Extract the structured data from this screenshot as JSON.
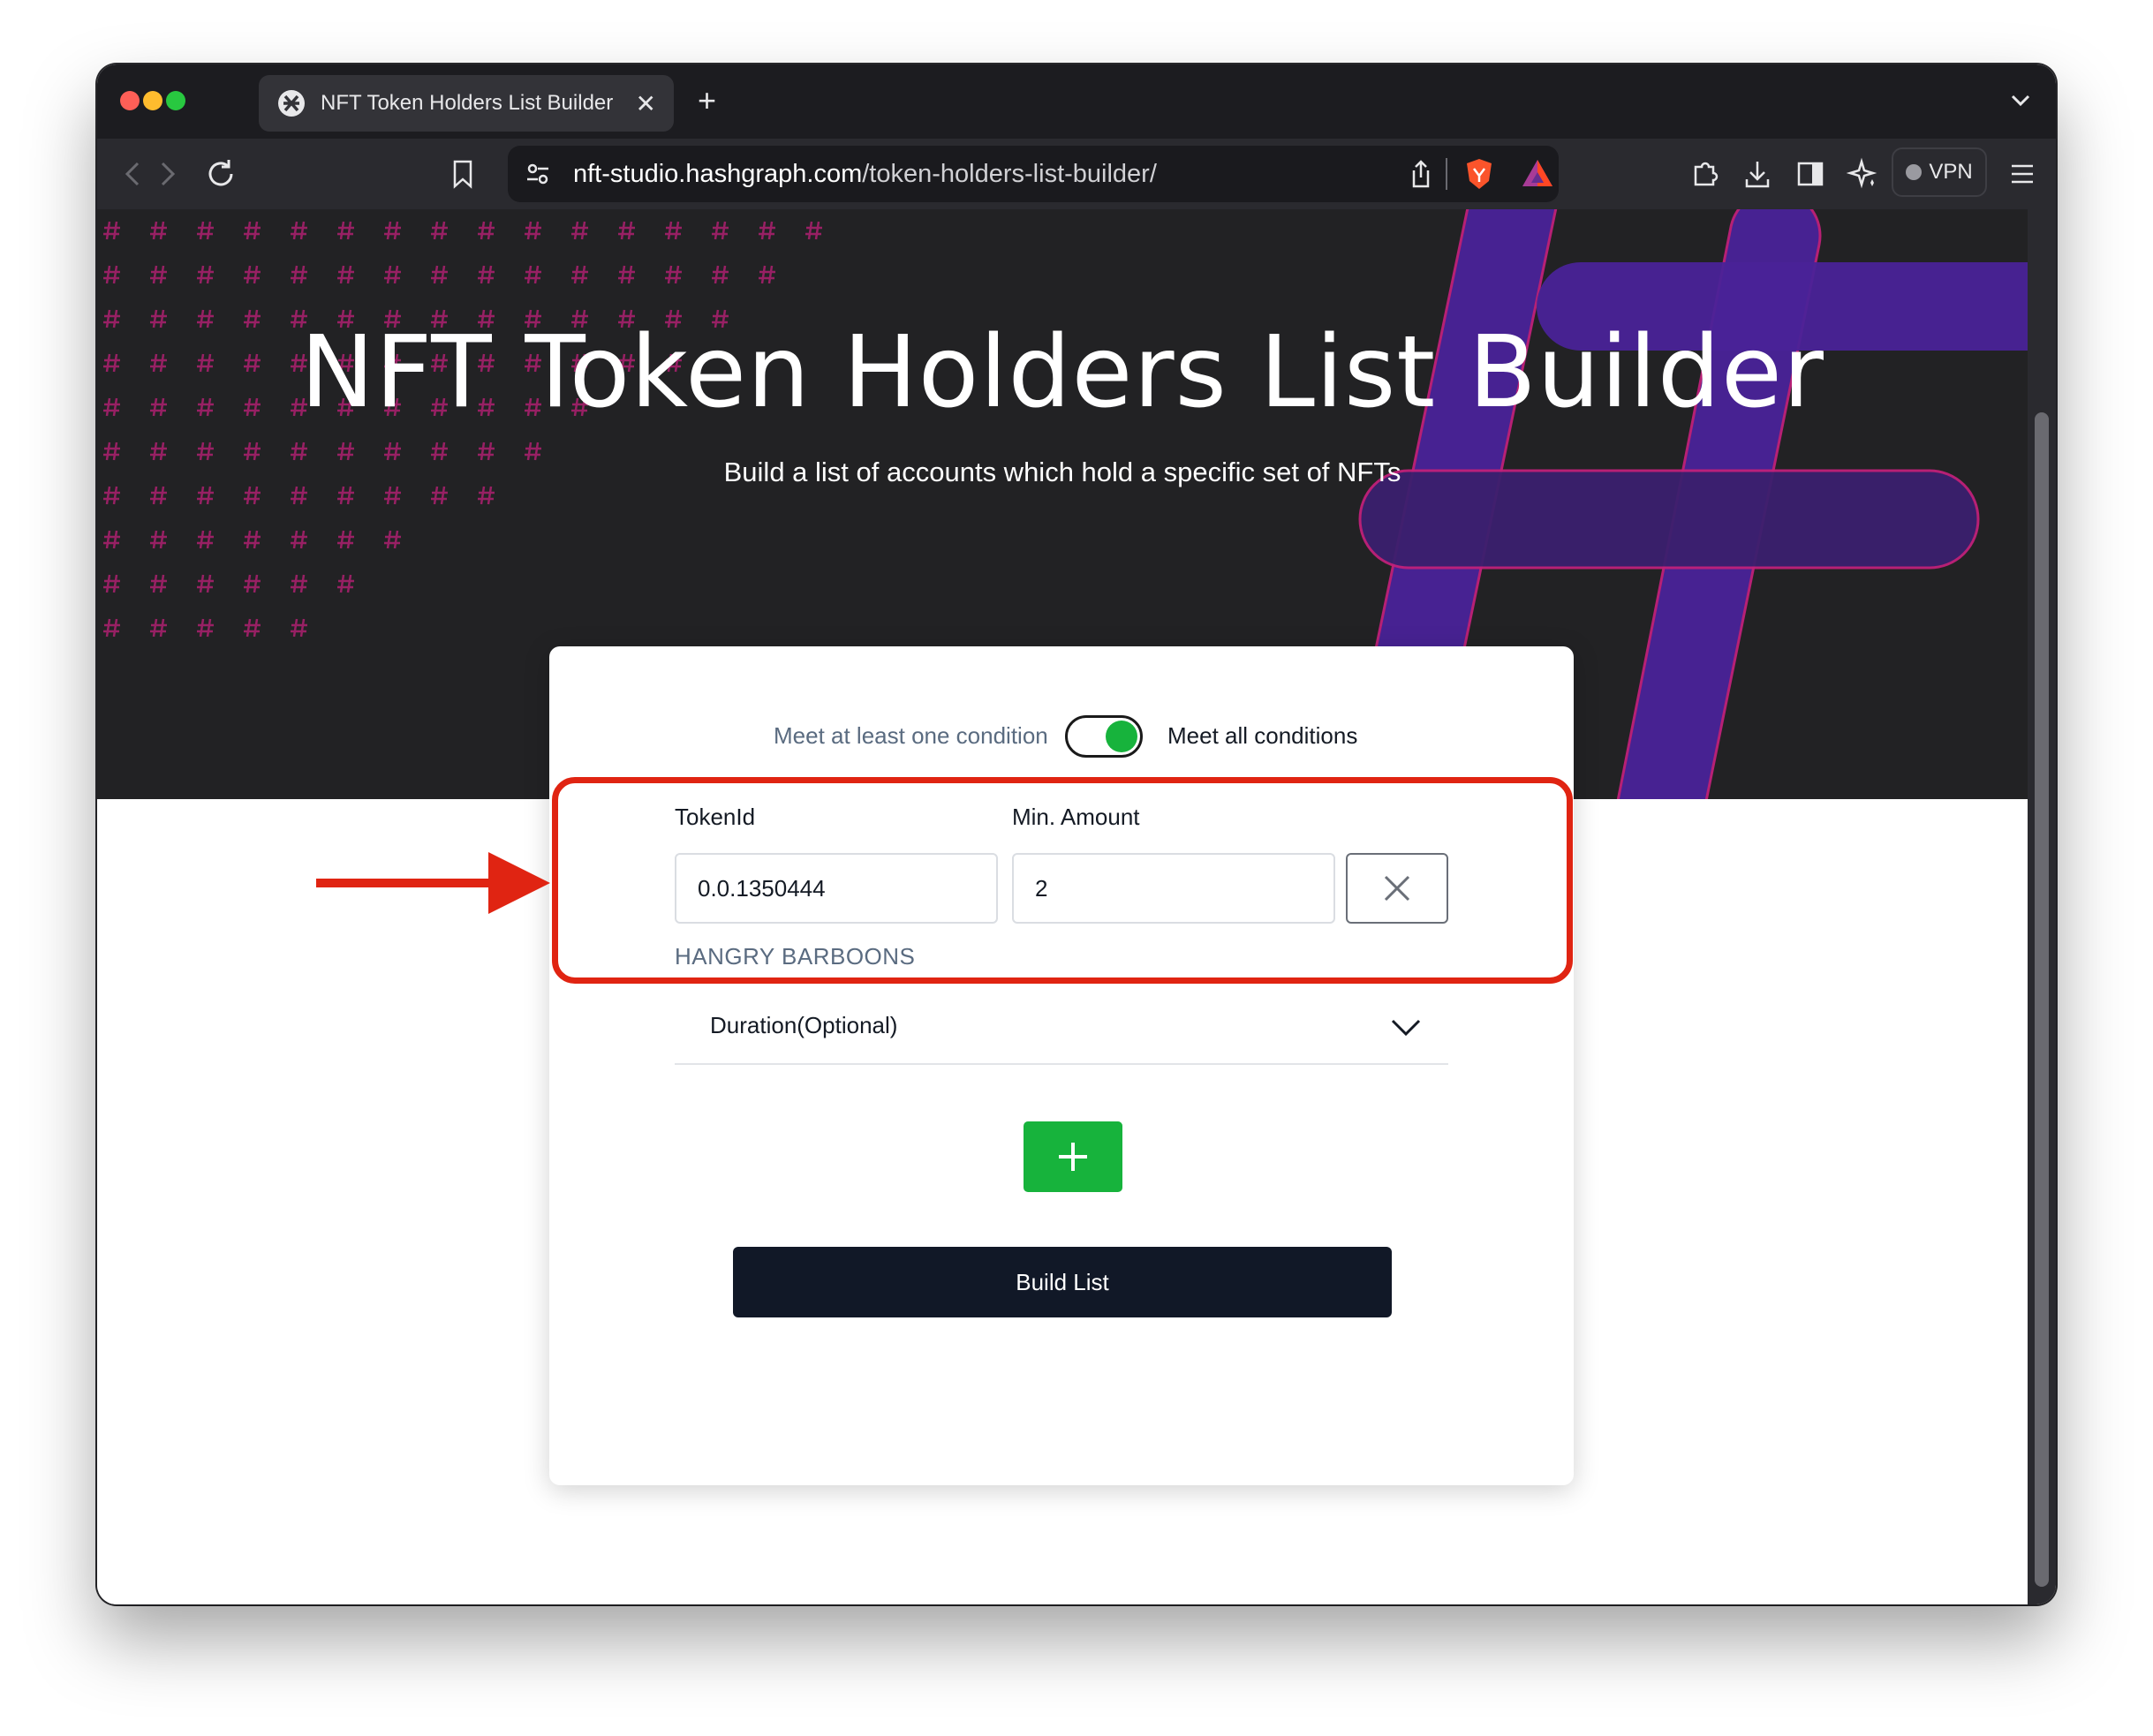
{
  "browser": {
    "tab_title": "NFT Token Holders List Builder",
    "new_tab_label": "+",
    "url_host": "nft-studio.hashgraph.com",
    "url_path": "/token-holders-list-builder/",
    "vpn_label": "VPN"
  },
  "hero": {
    "title": "NFT Token Holders List Builder",
    "subtitle": "Build a list of accounts which hold a specific set of NFTs"
  },
  "form": {
    "toggle_left_label": "Meet at least one condition",
    "toggle_right_label": "Meet all conditions",
    "toggle_on": true,
    "token_id_label": "TokenId",
    "token_id_value": "0.0.1350444",
    "min_amount_label": "Min. Amount",
    "min_amount_value": "2",
    "token_name": "HANGRY BARBOONS",
    "duration_label": "Duration(Optional)",
    "build_button_label": "Build List"
  },
  "colors": {
    "accent_green": "#17b33c",
    "hero_bg": "#222224",
    "hash_purple": "#5a2aa8",
    "hash_pink": "#c0207a",
    "annotation_red": "#e02412",
    "button_dark": "#111827"
  },
  "icons": [
    "brave-shield-icon",
    "bat-rewards-icon",
    "share-icon",
    "bookmark-icon",
    "reload-icon",
    "extensions-icon",
    "download-icon",
    "sidebar-icon",
    "leo-ai-icon",
    "menu-icon",
    "close-icon",
    "chevron-down-icon",
    "plus-icon"
  ]
}
